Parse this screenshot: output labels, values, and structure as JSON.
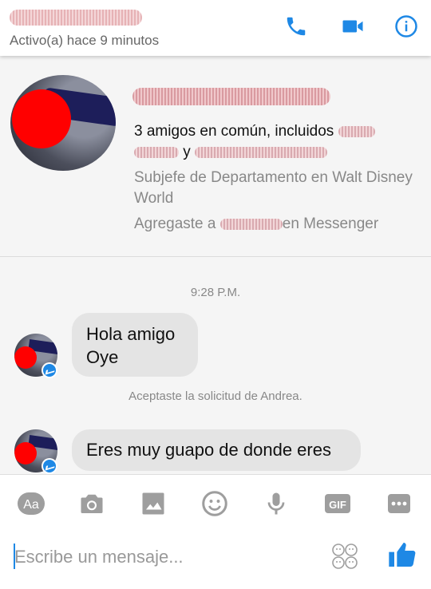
{
  "header": {
    "status": "Activo(a) hace 9 minutos",
    "call_icon": "phone-icon",
    "video_icon": "video-camera-icon",
    "info_icon": "info-icon",
    "accent": "#1e88e5"
  },
  "profile": {
    "mutual_prefix": "3 amigos en común, incluidos",
    "mutual_joiner": "y",
    "job": "Subjefe de Departamento en Walt Disney World",
    "added_prefix": "Agregaste a",
    "added_suffix": "en Messenger"
  },
  "conversation": {
    "timestamp": "9:28 P.M.",
    "message1_line1": "Hola amigo",
    "message1_line2": "Oye",
    "system_note": "Aceptaste la solicitud de Andrea.",
    "message2": "Eres muy guapo de donde eres"
  },
  "toolbar": {
    "aa_label": "Aa",
    "gif_label": "GIF",
    "input_placeholder": "Escribe un mensaje..."
  }
}
